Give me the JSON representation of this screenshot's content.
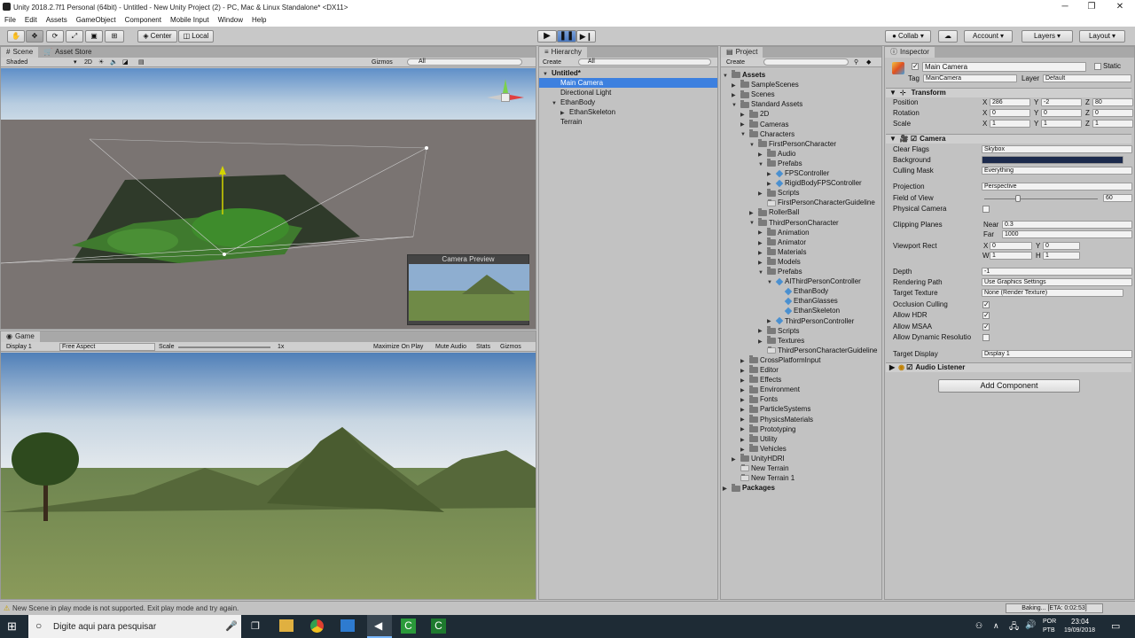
{
  "window": {
    "title": "Unity 2018.2.7f1 Personal (64bit) - Untitled - New Unity Project (2) - PC, Mac & Linux Standalone* <DX11>",
    "minimize": "─",
    "maximize": "❐",
    "close": "✕"
  },
  "menu": [
    "File",
    "Edit",
    "Assets",
    "GameObject",
    "Component",
    "Mobile Input",
    "Window",
    "Help"
  ],
  "toolbar": {
    "center": "Center",
    "local": "Local",
    "collab": "Collab ▾",
    "account": "Account",
    "layers": "Layers",
    "layout": "Layout"
  },
  "scene": {
    "tab": "Scene",
    "tab2": "Asset Store",
    "shading": "Shaded",
    "mode2d": "2D",
    "gizmos": "Gizmos",
    "search": "All",
    "camera_preview": "Camera Preview"
  },
  "game": {
    "tab": "Game",
    "display": "Display 1",
    "aspect": "Free Aspect",
    "scale_label": "Scale",
    "scale_value": "1x",
    "maximize": "Maximize On Play",
    "mute": "Mute Audio",
    "stats": "Stats",
    "gizmos": "Gizmos"
  },
  "hierarchy": {
    "tab": "Hierarchy",
    "create": "Create",
    "search": "All",
    "items": [
      {
        "label": "Untitled*",
        "depth": 0,
        "fold": "▼",
        "bold": true
      },
      {
        "label": "Main Camera",
        "depth": 1,
        "fold": "",
        "sel": true
      },
      {
        "label": "Directional Light",
        "depth": 1,
        "fold": ""
      },
      {
        "label": "EthanBody",
        "depth": 1,
        "fold": "▼"
      },
      {
        "label": "EthanSkeleton",
        "depth": 2,
        "fold": "▶"
      },
      {
        "label": "Terrain",
        "depth": 1,
        "fold": ""
      }
    ]
  },
  "project": {
    "tab": "Project",
    "create": "Create",
    "items": [
      {
        "label": "Assets",
        "d": 0,
        "f": "▼",
        "t": "folder",
        "b": true
      },
      {
        "label": "SampleScenes",
        "d": 1,
        "f": "▶",
        "t": "folder"
      },
      {
        "label": "Scenes",
        "d": 1,
        "f": "▶",
        "t": "folder"
      },
      {
        "label": "Standard Assets",
        "d": 1,
        "f": "▼",
        "t": "folder"
      },
      {
        "label": "2D",
        "d": 2,
        "f": "▶",
        "t": "folder"
      },
      {
        "label": "Cameras",
        "d": 2,
        "f": "▶",
        "t": "folder"
      },
      {
        "label": "Characters",
        "d": 2,
        "f": "▼",
        "t": "folder"
      },
      {
        "label": "FirstPersonCharacter",
        "d": 3,
        "f": "▼",
        "t": "folder"
      },
      {
        "label": "Audio",
        "d": 4,
        "f": "▶",
        "t": "folder"
      },
      {
        "label": "Prefabs",
        "d": 4,
        "f": "▼",
        "t": "folder"
      },
      {
        "label": "FPSController",
        "d": 5,
        "f": "▶",
        "t": "prefab"
      },
      {
        "label": "RigidBodyFPSController",
        "d": 5,
        "f": "▶",
        "t": "prefab"
      },
      {
        "label": "Scripts",
        "d": 4,
        "f": "▶",
        "t": "folder"
      },
      {
        "label": "FirstPersonCharacterGuideline",
        "d": 4,
        "f": "",
        "t": "doc"
      },
      {
        "label": "RollerBall",
        "d": 3,
        "f": "▶",
        "t": "folder"
      },
      {
        "label": "ThirdPersonCharacter",
        "d": 3,
        "f": "▼",
        "t": "folder"
      },
      {
        "label": "Animation",
        "d": 4,
        "f": "▶",
        "t": "folder"
      },
      {
        "label": "Animator",
        "d": 4,
        "f": "▶",
        "t": "folder"
      },
      {
        "label": "Materials",
        "d": 4,
        "f": "▶",
        "t": "folder"
      },
      {
        "label": "Models",
        "d": 4,
        "f": "▶",
        "t": "folder"
      },
      {
        "label": "Prefabs",
        "d": 4,
        "f": "▼",
        "t": "folder"
      },
      {
        "label": "AIThirdPersonController",
        "d": 5,
        "f": "▼",
        "t": "prefab"
      },
      {
        "label": "EthanBody",
        "d": 6,
        "f": "",
        "t": "prefab"
      },
      {
        "label": "EthanGlasses",
        "d": 6,
        "f": "",
        "t": "prefab"
      },
      {
        "label": "EthanSkeleton",
        "d": 6,
        "f": "",
        "t": "prefab"
      },
      {
        "label": "ThirdPersonController",
        "d": 5,
        "f": "▶",
        "t": "prefab"
      },
      {
        "label": "Scripts",
        "d": 4,
        "f": "▶",
        "t": "folder"
      },
      {
        "label": "Textures",
        "d": 4,
        "f": "▶",
        "t": "folder"
      },
      {
        "label": "ThirdPersonCharacterGuideline",
        "d": 4,
        "f": "",
        "t": "doc"
      },
      {
        "label": "CrossPlatformInput",
        "d": 2,
        "f": "▶",
        "t": "folder"
      },
      {
        "label": "Editor",
        "d": 2,
        "f": "▶",
        "t": "folder"
      },
      {
        "label": "Effects",
        "d": 2,
        "f": "▶",
        "t": "folder"
      },
      {
        "label": "Environment",
        "d": 2,
        "f": "▶",
        "t": "folder"
      },
      {
        "label": "Fonts",
        "d": 2,
        "f": "▶",
        "t": "folder"
      },
      {
        "label": "ParticleSystems",
        "d": 2,
        "f": "▶",
        "t": "folder"
      },
      {
        "label": "PhysicsMaterials",
        "d": 2,
        "f": "▶",
        "t": "folder"
      },
      {
        "label": "Prototyping",
        "d": 2,
        "f": "▶",
        "t": "folder"
      },
      {
        "label": "Utility",
        "d": 2,
        "f": "▶",
        "t": "folder"
      },
      {
        "label": "Vehicles",
        "d": 2,
        "f": "▶",
        "t": "folder"
      },
      {
        "label": "UnityHDRI",
        "d": 1,
        "f": "▶",
        "t": "folder"
      },
      {
        "label": "New Terrain",
        "d": 1,
        "f": "",
        "t": "doc"
      },
      {
        "label": "New Terrain 1",
        "d": 1,
        "f": "",
        "t": "doc"
      },
      {
        "label": "Packages",
        "d": 0,
        "f": "▶",
        "t": "folder",
        "b": true
      }
    ]
  },
  "inspector": {
    "tab": "Inspector",
    "name": "Main Camera",
    "static": "Static",
    "tag_label": "Tag",
    "tag": "MainCamera",
    "layer_label": "Layer",
    "layer": "Default",
    "transform": {
      "title": "Transform",
      "position": "Position",
      "rotation": "Rotation",
      "scale": "Scale",
      "px": "286",
      "py": "-2",
      "pz": "80",
      "rx": "0",
      "ry": "0",
      "rz": "0",
      "sx": "1",
      "sy": "1",
      "sz": "1",
      "xl": "X",
      "yl": "Y",
      "zl": "Z"
    },
    "camera": {
      "title": "Camera",
      "clear_flags": "Clear Flags",
      "clear_flags_v": "Skybox",
      "background": "Background",
      "background_color": "#1c2a4c",
      "culling": "Culling Mask",
      "culling_v": "Everything",
      "projection": "Projection",
      "projection_v": "Perspective",
      "fov": "Field of View",
      "fov_v": "60",
      "fov_fraction": 0.27,
      "physical": "Physical Camera",
      "clipping": "Clipping Planes",
      "near_l": "Near",
      "near": "0.3",
      "far_l": "Far",
      "far": "1000",
      "viewport": "Viewport Rect",
      "vx": "0",
      "vy": "0",
      "vw": "1",
      "vh": "1",
      "wl": "W",
      "hl": "H",
      "depth": "Depth",
      "depth_v": "-1",
      "rendering": "Rendering Path",
      "rendering_v": "Use Graphics Settings",
      "target_tex": "Target Texture",
      "target_tex_v": "None (Render Texture)",
      "occlusion": "Occlusion Culling",
      "hdr": "Allow HDR",
      "msaa": "Allow MSAA",
      "dynres": "Allow Dynamic Resolutio",
      "target_disp": "Target Display",
      "target_disp_v": "Display 1"
    },
    "audio": {
      "title": "Audio Listener"
    },
    "add_component": "Add Component"
  },
  "status": {
    "message": "New Scene in play mode is not supported. Exit play mode and try again.",
    "baking": "Baking... [ETA: 0:02:53]"
  },
  "taskbar": {
    "search": "Digite aqui para pesquisar",
    "lang1": "POR",
    "lang2": "PTB",
    "time": "23:04",
    "date": "19/09/2018"
  }
}
